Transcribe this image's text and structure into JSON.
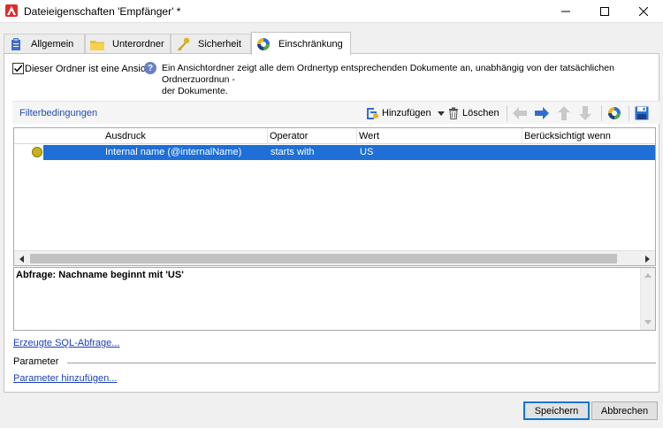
{
  "window": {
    "title": "Dateieigenschaften 'Empfänger' *",
    "minimize_glyph": "minimize-icon",
    "maximize_glyph": "maximize-icon",
    "close_glyph": "close-icon"
  },
  "tabs": [
    {
      "label": "Allgemein",
      "icon": "clipboard-icon",
      "active": false
    },
    {
      "label": "Unterordner",
      "icon": "folder-icon",
      "active": false
    },
    {
      "label": "Sicherheit",
      "icon": "key-icon",
      "active": false
    },
    {
      "label": "Einschränkung",
      "icon": "filter-pie-icon",
      "active": true
    }
  ],
  "view_folder": {
    "checkbox_label": "Dieser Ordner ist eine Ansicht",
    "checked": true,
    "info_line1": "Ein Ansichtordner zeigt alle dem Ordnertyp entsprechenden Dokumente an, unabhängig von der tatsächlichen Ordnerzuordnun -",
    "info_line2": "der Dokumente."
  },
  "filter": {
    "title": "Filterbedingungen",
    "add_label": "Hinzufügen",
    "delete_label": "Löschen"
  },
  "grid": {
    "columns": [
      "Ausdruck",
      "Operator",
      "Wert",
      "Berücksichtigt wenn"
    ],
    "rows": [
      {
        "expression": "Internal name (@internalName)",
        "operator": "starts with",
        "value": "US",
        "condition": ""
      }
    ]
  },
  "query": {
    "text": "Abfrage: Nachname beginnt mit 'US'"
  },
  "links": {
    "sql": "Erzeugte SQL-Abfrage...",
    "add_param": "Parameter hinzufügen..."
  },
  "parameter_label": "Parameter",
  "buttons": {
    "save": "Speichern",
    "cancel": "Abbrechen"
  },
  "colors": {
    "selection": "#1e6fd6",
    "link": "#1a3fb8",
    "app_icon": "#d9302c"
  }
}
